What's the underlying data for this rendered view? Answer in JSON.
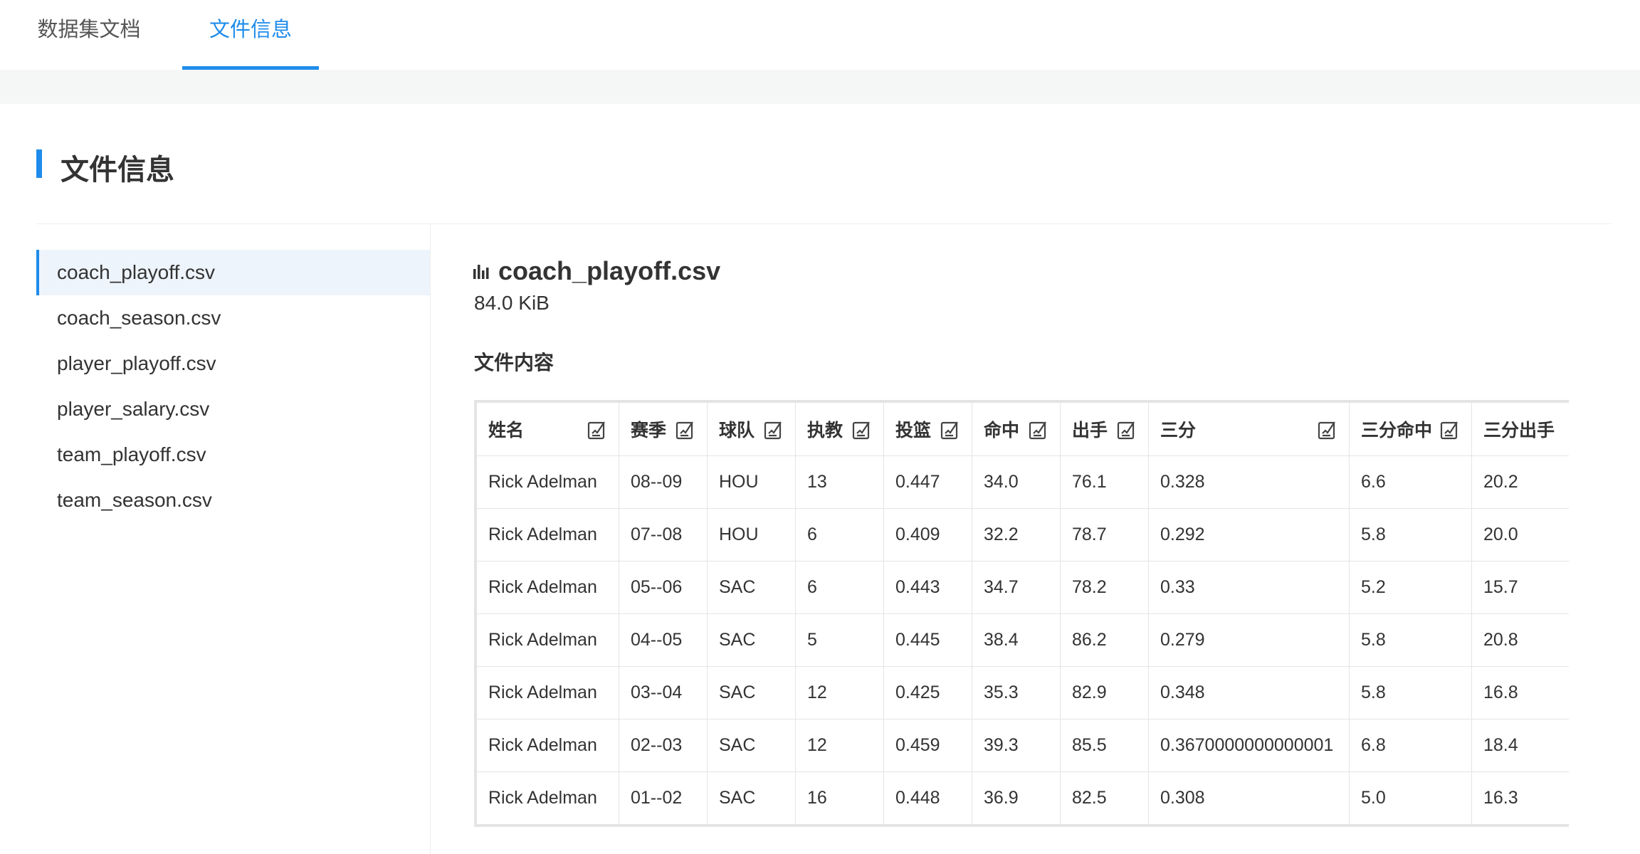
{
  "tabs": [
    {
      "label": "数据集文档",
      "active": false
    },
    {
      "label": "文件信息",
      "active": true
    }
  ],
  "section_title": "文件信息",
  "files": [
    {
      "name": "coach_playoff.csv",
      "active": true
    },
    {
      "name": "coach_season.csv",
      "active": false
    },
    {
      "name": "player_playoff.csv",
      "active": false
    },
    {
      "name": "player_salary.csv",
      "active": false
    },
    {
      "name": "team_playoff.csv",
      "active": false
    },
    {
      "name": "team_season.csv",
      "active": false
    }
  ],
  "file_detail": {
    "icon": "bar-chart-icon",
    "name": "coach_playoff.csv",
    "size": "84.0 KiB",
    "content_title": "文件内容"
  },
  "table": {
    "columns": [
      "姓名",
      "赛季",
      "球队",
      "执教",
      "投篮",
      "命中",
      "出手",
      "三分",
      "三分命中",
      "三分出手"
    ],
    "rows": [
      [
        "Rick Adelman",
        "08--09",
        "HOU",
        "13",
        "0.447",
        "34.0",
        "76.1",
        "0.328",
        "6.6",
        "20.2"
      ],
      [
        "Rick Adelman",
        "07--08",
        "HOU",
        "6",
        "0.409",
        "32.2",
        "78.7",
        "0.292",
        "5.8",
        "20.0"
      ],
      [
        "Rick Adelman",
        "05--06",
        "SAC",
        "6",
        "0.443",
        "34.7",
        "78.2",
        "0.33",
        "5.2",
        "15.7"
      ],
      [
        "Rick Adelman",
        "04--05",
        "SAC",
        "5",
        "0.445",
        "38.4",
        "86.2",
        "0.279",
        "5.8",
        "20.8"
      ],
      [
        "Rick Adelman",
        "03--04",
        "SAC",
        "12",
        "0.425",
        "35.3",
        "82.9",
        "0.348",
        "5.8",
        "16.8"
      ],
      [
        "Rick Adelman",
        "02--03",
        "SAC",
        "12",
        "0.459",
        "39.3",
        "85.5",
        "0.3670000000000001",
        "6.8",
        "18.4"
      ],
      [
        "Rick Adelman",
        "01--02",
        "SAC",
        "16",
        "0.448",
        "36.9",
        "82.5",
        "0.308",
        "5.0",
        "16.3"
      ]
    ]
  },
  "colors": {
    "accent": "#1f8ceb",
    "band": "#f5f7f7",
    "active_bg": "#eef4fb"
  }
}
